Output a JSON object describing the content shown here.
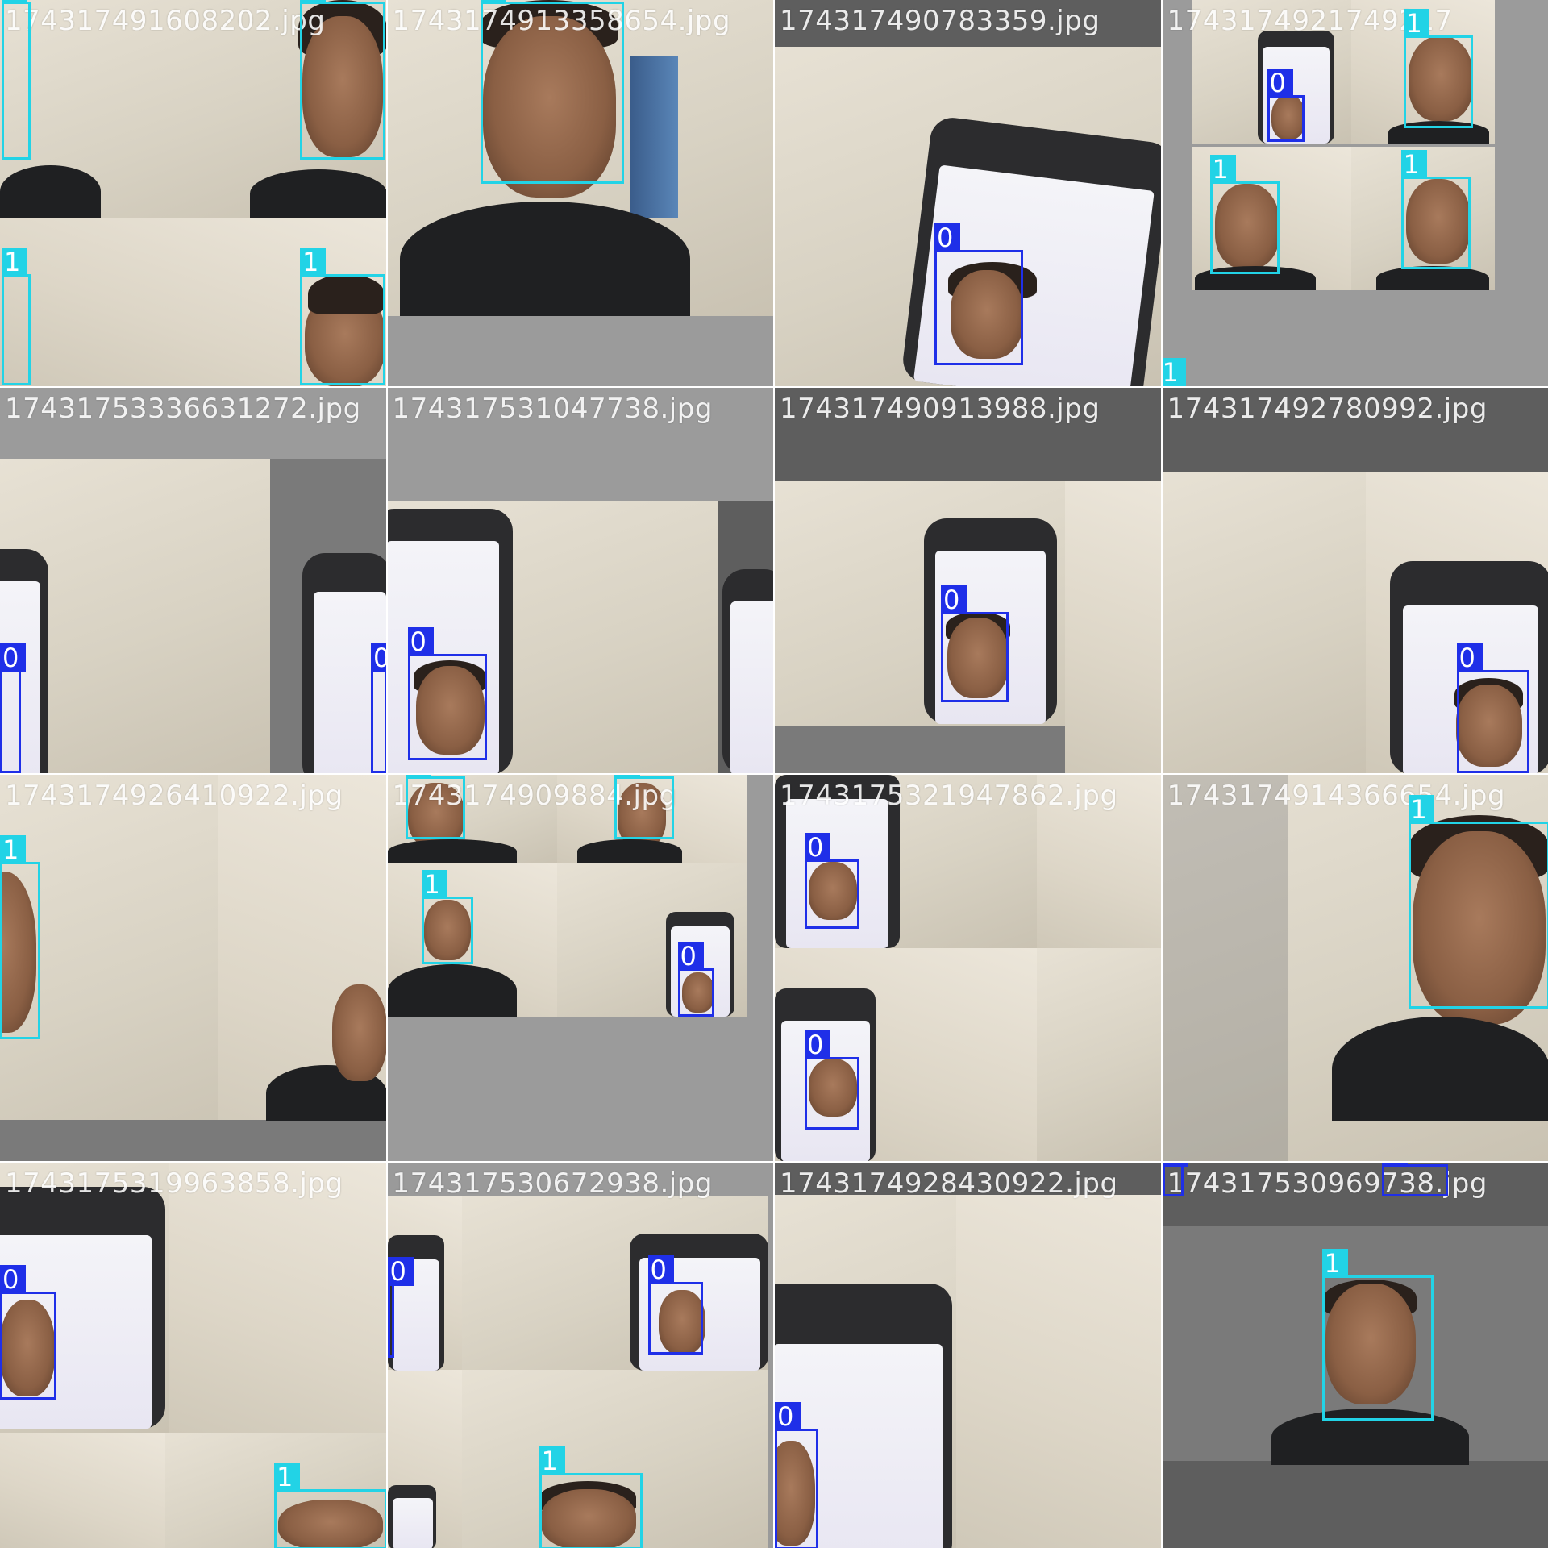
{
  "tiles": [
    {
      "filename": "1743174916082​02.jpg",
      "labels": [
        "1",
        "1",
        "1",
        "1"
      ]
    },
    {
      "filename": "1743174913358654.jpg",
      "labels": [
        "1"
      ]
    },
    {
      "filename": "174317490783359.jpg",
      "labels": [
        "0"
      ]
    },
    {
      "filename": "1743174921749217",
      "labels": [
        "0",
        "1",
        "1",
        "1",
        "1"
      ]
    },
    {
      "filename": "1743175333663127​2.jpg",
      "labels": [
        "0",
        "0"
      ]
    },
    {
      "filename": "174317531047738.jpg",
      "labels": [
        "0"
      ]
    },
    {
      "filename": "174317490913988.jpg",
      "labels": [
        "0"
      ]
    },
    {
      "filename": "174317492780992.jpg",
      "labels": [
        "0"
      ]
    },
    {
      "filename": "1743174926410922.jpg",
      "labels": [
        "1"
      ]
    },
    {
      "filename": "1743174909884.jpg",
      "labels": [
        "1",
        "1",
        "1",
        "0"
      ]
    },
    {
      "filename": "1743175321947862.jpg",
      "labels": [
        "0",
        "0"
      ]
    },
    {
      "filename": "1743174914366654.jpg",
      "labels": [
        "1"
      ]
    },
    {
      "filename": "1743175319963858.jpg",
      "labels": [
        "0",
        "1"
      ]
    },
    {
      "filename": "174317530672938.jpg",
      "labels": [
        "0",
        "0",
        "1"
      ]
    },
    {
      "filename": "1743174928430922.jpg",
      "labels": [
        "0"
      ]
    },
    {
      "filename": "174317530969738.jpg",
      "labels": [
        "0",
        "0",
        "1"
      ]
    }
  ],
  "class_colors": {
    "0": "#1f2fe8",
    "1": "#22d3e6"
  }
}
